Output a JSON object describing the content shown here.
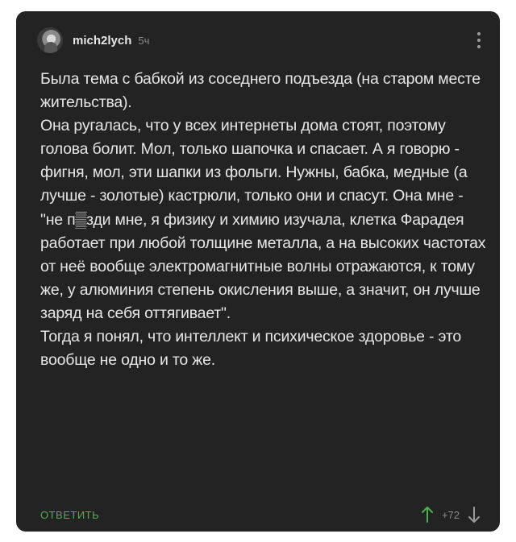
{
  "post": {
    "username": "mich2lych",
    "time": "5ч",
    "paragraphs": [
      "Была тема с бабкой из соседнего подъезда (на старом месте жительства).",
      "Она ругалась, что у всех интернеты дома стоят, поэтому голова болит. Мол, только шапочка и спасает. А я говорю - фигня, мол, эти шапки из фольги. Нужны, бабка, медные (а лучше - золотые) кастрюли, только они и спасут. Она мне - \"не п▒зди мне, я физику и химию изучала, клетка Фарадея работает при любой толщине металла, а на высоких частотах от неё вообще электромагнитные волны отражаются, к тому же, у алюминия степень окисления выше, а значит, он лучше заряд на себя оттягивает\".",
      "Тогда я понял, что интеллект и психическое здоровье - это вообще не одно и то же."
    ]
  },
  "actions": {
    "reply_label": "ОТВЕТИТЬ",
    "rating": "+72"
  },
  "icons": {
    "avatar": "avatar",
    "menu": "more-vertical-icon",
    "upvote": "arrow-up-icon",
    "downvote": "arrow-down-icon"
  },
  "colors": {
    "card_background": "#232323",
    "text": "#e6e6e6",
    "muted": "#8a8a8a",
    "accent_green": "#4caf50",
    "downvote": "#9a9a9a"
  }
}
